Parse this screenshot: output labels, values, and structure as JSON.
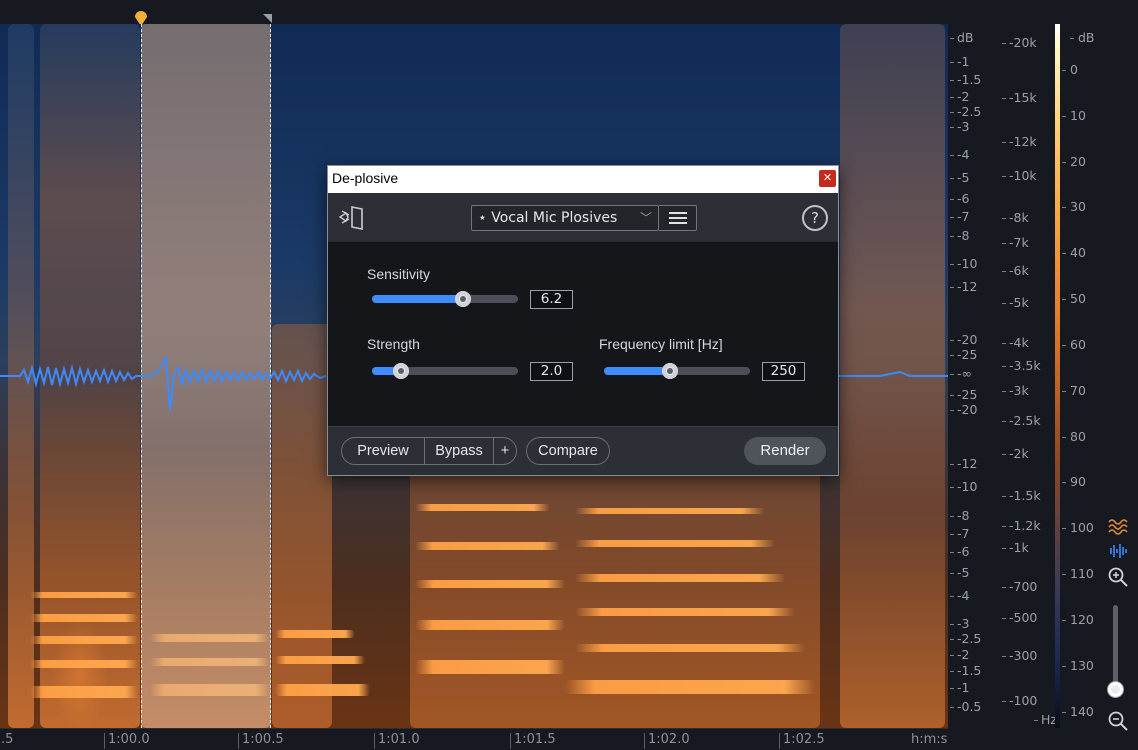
{
  "dialog": {
    "title": "De-plosive",
    "close_glyph": "✕",
    "preset": {
      "label": "⋆ Vocal Mic Plosives",
      "chevron": "﹀"
    },
    "help_glyph": "?",
    "params": {
      "sensitivity": {
        "label": "Sensitivity",
        "value": "6.2",
        "fraction": 0.62
      },
      "strength": {
        "label": "Strength",
        "value": "2.0",
        "fraction": 0.2
      },
      "frequency_limit": {
        "label": "Frequency limit [Hz]",
        "value": "250",
        "fraction": 0.45
      }
    },
    "footer": {
      "preview": "Preview",
      "bypass": "Bypass",
      "plus": "+",
      "compare": "Compare",
      "render": "Render"
    }
  },
  "time_ruler": {
    "labels": [
      ".5",
      "1:00.0",
      "1:00.5",
      "1:01.0",
      "1:01.5",
      "1:02.0",
      "1:02.5",
      "h:m:s"
    ]
  },
  "db_scale": {
    "labels": [
      "dB",
      "-1",
      "-1.5",
      "-2",
      "-2.5",
      "-3",
      "-4",
      "-5",
      "-6",
      "-7",
      "-8",
      "-10",
      "-12",
      "-20",
      "-25",
      "-∞",
      "-25",
      "-20",
      "-12",
      "-10",
      "-8",
      "-7",
      "-6",
      "-5",
      "-4",
      "-3",
      "-2.5",
      "-2",
      "-1.5",
      "-1",
      "-0.5"
    ]
  },
  "hz_scale": {
    "labels": [
      "-20k",
      "-15k",
      "-12k",
      "-10k",
      "-8k",
      "-7k",
      "-6k",
      "-5k",
      "-4k",
      "-3.5k",
      "-3k",
      "-2.5k",
      "-2k",
      "-1.5k",
      "-1.2k",
      "-1k",
      "-700",
      "-500",
      "-300",
      "-100",
      "Hz"
    ]
  },
  "colorbar": {
    "unit": "dB",
    "labels": [
      "0",
      "10",
      "20",
      "30",
      "40",
      "50",
      "60",
      "70",
      "80",
      "90",
      "100",
      "110",
      "120",
      "130",
      "140"
    ]
  },
  "zoom": {
    "level_fraction": 0.05
  },
  "colors": {
    "accent": "#3f8cff",
    "playhead": "#f2b23a",
    "close": "#c42b1c"
  }
}
